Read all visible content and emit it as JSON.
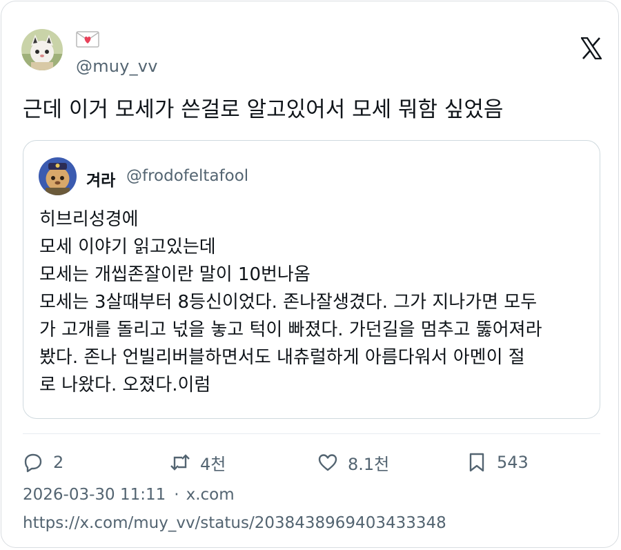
{
  "author": {
    "display_name_icon": "love-letter-emoji",
    "handle": "@muy_vv",
    "avatar": "avatar"
  },
  "brand_icon": "x-logo-icon",
  "tweet": {
    "text": "근데 이거 모세가 쓴걸로 알고있어서 모세 뭐함 싶었음"
  },
  "quoted": {
    "display_name": "겨라",
    "handle": "@frodofeltafool",
    "lines": [
      "히브리성경에",
      "모세 이야기 읽고있는데",
      "모세는 개씹존잘이란 말이 10번나옴",
      "모세는 3살때부터 8등신이었다. 존나잘생겼다. 그가 지나가면 모두",
      "가 고개를 돌리고 넋을 놓고 턱이 빠졌다. 가던길을 멈추고 뚫어져라",
      "봤다. 존나 언빌리버블하면서도 내츄럴하게 아름다워서 아멘이 절",
      "로 나왔다. 오졌다.이럼"
    ]
  },
  "actions": {
    "reply": {
      "icon": "reply-icon",
      "count": "2"
    },
    "retweet": {
      "icon": "retweet-icon",
      "count": "4천"
    },
    "like": {
      "icon": "heart-icon",
      "count": "8.1천"
    },
    "bookmark": {
      "icon": "bookmark-icon",
      "count": "543"
    }
  },
  "meta": {
    "timestamp": "2026-03-30 11:11",
    "separator": "·",
    "source": "x.com",
    "url": "https://x.com/muy_vv/status/2038438969403433348"
  },
  "colors": {
    "text": "#0f1419",
    "secondary": "#536471",
    "border": "#cfd9de",
    "heart_pink": "#f0839b"
  }
}
